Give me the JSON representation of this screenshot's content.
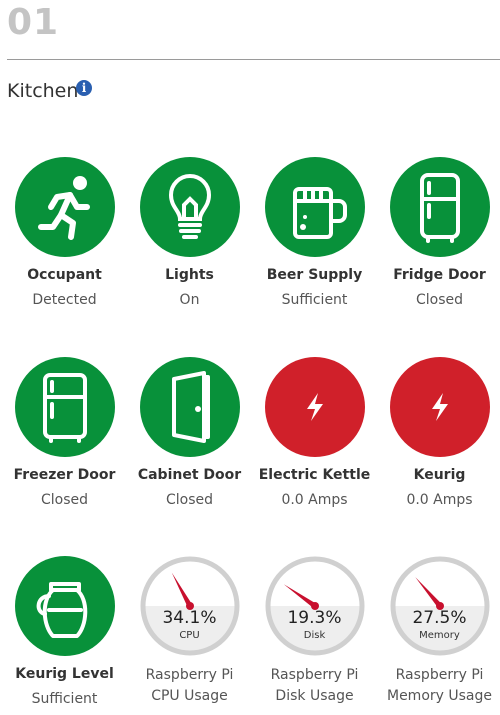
{
  "header": {
    "page_number": "01"
  },
  "section": {
    "title": "Kitchen",
    "info_icon": "i"
  },
  "colors": {
    "ok": "#08913a",
    "alert": "#d0202a",
    "gauge_ring": "#d0d0d0",
    "needle": "#c8102e"
  },
  "tiles": [
    {
      "name": "Occupant",
      "state": "Detected",
      "icon": "running-person-icon"
    },
    {
      "name": "Lights",
      "state": "On",
      "icon": "lightbulb-icon"
    },
    {
      "name": "Beer Supply",
      "state": "Sufficient",
      "icon": "beer-mug-icon"
    },
    {
      "name": "Fridge Door",
      "state": "Closed",
      "icon": "fridge-icon"
    },
    {
      "name": "Freezer Door",
      "state": "Closed",
      "icon": "fridge-icon"
    },
    {
      "name": "Cabinet Door",
      "state": "Closed",
      "icon": "door-icon"
    },
    {
      "name": "Electric Kettle",
      "state": "0.0 Amps",
      "icon": "lightning-icon"
    },
    {
      "name": "Keurig",
      "state": "0.0 Amps",
      "icon": "lightning-icon"
    },
    {
      "name": "Keurig Level",
      "state": "Sufficient",
      "icon": "coffee-pot-icon"
    }
  ],
  "gauges": [
    {
      "value": "34.1%",
      "percent": 34.1,
      "label": "CPU",
      "name": "Raspberry Pi",
      "sub": "CPU Usage"
    },
    {
      "value": "19.3%",
      "percent": 19.3,
      "label": "Disk",
      "name": "Raspberry Pi",
      "sub": "Disk Usage"
    },
    {
      "value": "27.5%",
      "percent": 27.5,
      "label": "Memory",
      "name": "Raspberry Pi",
      "sub": "Memory Usage"
    }
  ]
}
